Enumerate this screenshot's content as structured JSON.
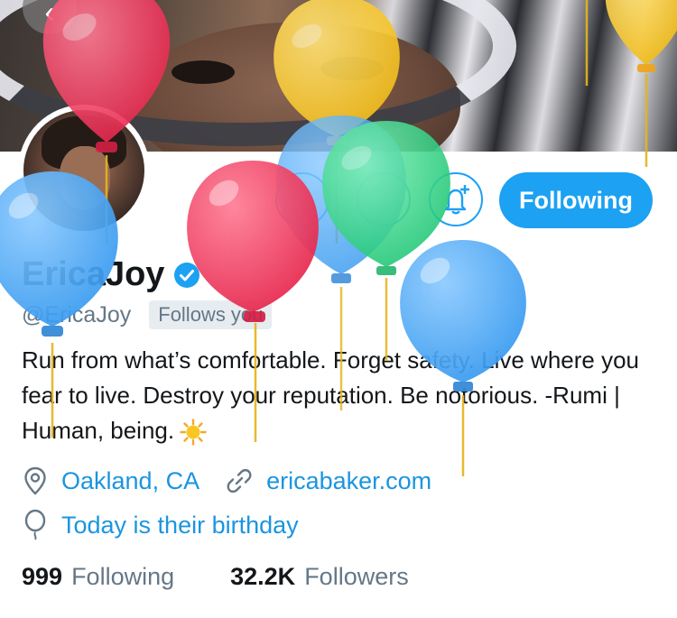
{
  "profile": {
    "name": "EricaJoy",
    "handle": "@EricaJoy",
    "follows_you": "Follows you",
    "bio": "Run from what’s comfortable. Forget safety. Live where you fear to live. Destroy your reputation. Be notorious. -Rumi | Human, being.",
    "bio_emoji": "sun-emoji",
    "location": "Oakland, CA",
    "website": "ericabaker.com",
    "birthday": "Today is their birthday"
  },
  "actions": {
    "follow_label": "Following",
    "back_icon": "back-arrow-icon",
    "notify_icon": "bell-plus-icon"
  },
  "stats": {
    "following_count": "999",
    "following_label": "Following",
    "followers_count": "32.2K",
    "followers_label": "Followers"
  },
  "colors": {
    "accent": "#1da1f2",
    "link": "#1b95e0",
    "text": "#14171a",
    "muted": "#657786",
    "balloon_red": "#ee3f62",
    "balloon_yellow": "#f7c934",
    "balloon_blue": "#4aa8f2",
    "balloon_green": "#35d486"
  },
  "decorations": {
    "balloons": "birthday-balloons"
  }
}
